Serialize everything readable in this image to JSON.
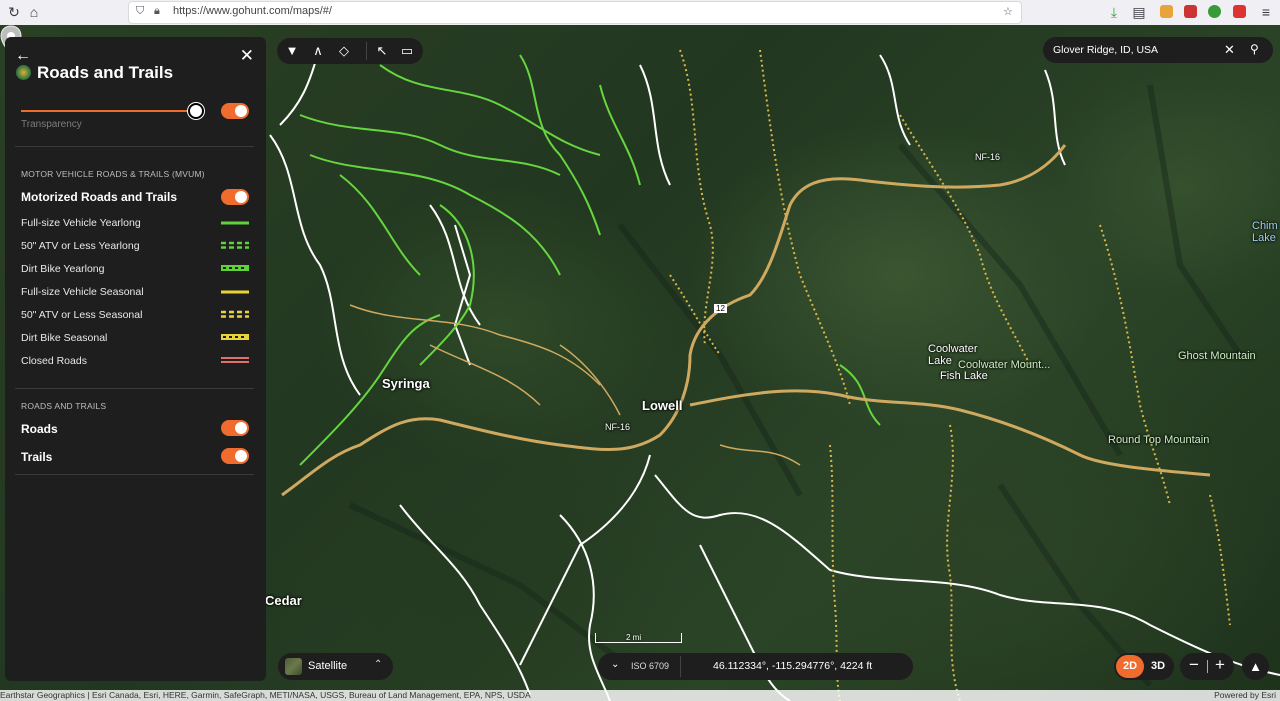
{
  "browser": {
    "url": "https://www.gohunt.com/maps/#/"
  },
  "panel": {
    "title": "Roads and Trails",
    "transparency_label": "Transparency",
    "section1_header": "MOTOR VEHICLE ROADS & TRAILS (MVUM)",
    "motorized_label": "Motorized Roads and Trails",
    "legend": [
      {
        "label": "Full-size Vehicle Yearlong",
        "color": "#5fd23a",
        "style": "solid"
      },
      {
        "label": "50\" ATV or Less Yearlong",
        "color": "#5fd23a",
        "style": "dashed"
      },
      {
        "label": "Dirt Bike Yearlong",
        "color": "#5fd23a",
        "style": "dotted"
      },
      {
        "label": "Full-size Vehicle Seasonal",
        "color": "#e8d43a",
        "style": "solid"
      },
      {
        "label": "50\" ATV or Less Seasonal",
        "color": "#e8d43a",
        "style": "dashed"
      },
      {
        "label": "Dirt Bike Seasonal",
        "color": "#e8d43a",
        "style": "dotted"
      },
      {
        "label": "Closed Roads",
        "color": "#e0706a",
        "style": "double"
      }
    ],
    "section2_header": "ROADS AND TRAILS",
    "roads_label": "Roads",
    "trails_label": "Trails"
  },
  "search": {
    "value": "Glover Ridge, ID, USA"
  },
  "map_labels": {
    "coolwater_lake": "Coolwater\nLake",
    "coolwater_mountain": "Coolwater Mount...",
    "ghost_mountain": "Ghost Mountain",
    "round_top": "Round Top Mountain",
    "lowell": "Lowell",
    "syringa": "Syringa",
    "cedar": "Cedar",
    "nf16_a": "NF-16",
    "nf16_b": "NF-16",
    "hwy12": "12",
    "fish_lake": "Fish Lake",
    "lake_edge": "Chim\nLake"
  },
  "basemap": {
    "label": "Satellite"
  },
  "coords": {
    "iso": "ISO 6709",
    "value": "46.112334°, -115.294776°, 4224 ft"
  },
  "view": {
    "mode_2d": "2D",
    "mode_3d": "3D"
  },
  "scale": {
    "label": "2 mi"
  },
  "attribution": {
    "left": "Earthstar Geographics | Esri Canada, Esri, HERE, Garmin, SafeGraph, METI/NASA, USGS, Bureau of Land Management, EPA, NPS, USDA",
    "right": "Powered by Esri"
  },
  "colors": {
    "accent": "#f06c2e",
    "panel": "#1e1e1e"
  }
}
